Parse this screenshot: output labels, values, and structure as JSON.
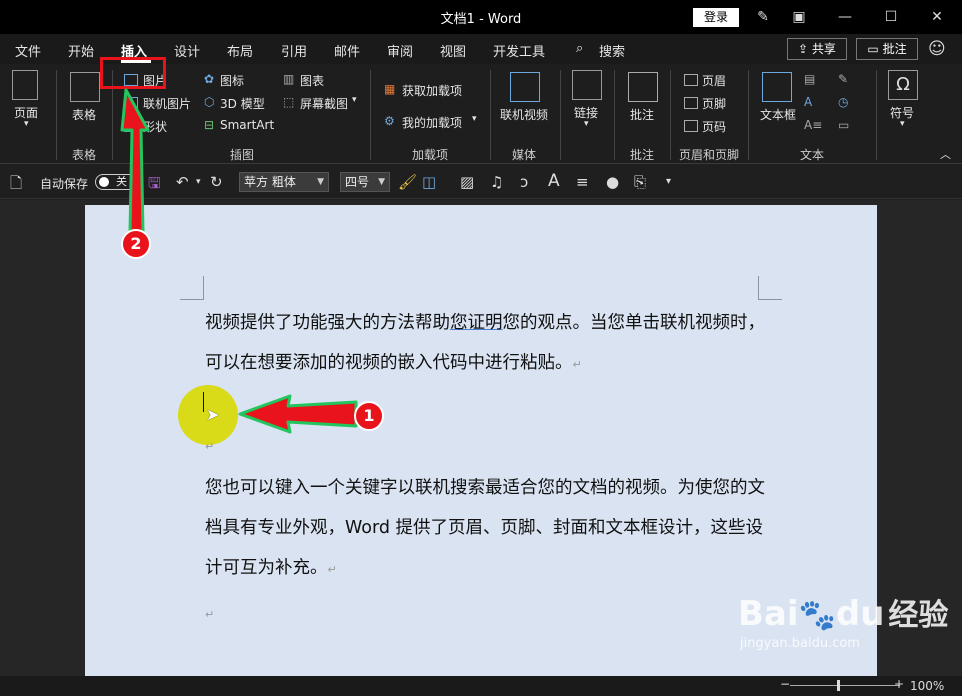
{
  "window": {
    "title": "文档1  -  Word",
    "login_label": "登录"
  },
  "tabs": [
    "文件",
    "开始",
    "插入",
    "设计",
    "布局",
    "引用",
    "邮件",
    "审阅",
    "视图",
    "开发工具",
    "搜索"
  ],
  "header_buttons": {
    "share": "共享",
    "comment": "批注"
  },
  "ribbon": {
    "page": "页面",
    "table": "表格",
    "table_group": "表格",
    "insert_items": [
      "图片",
      "联机图片",
      "形状",
      "图标",
      "3D 模型",
      "SmartArt",
      "图表",
      "屏幕截图"
    ],
    "insert_group": "插图",
    "addin_get": "获取加载项",
    "addin_mine": "我的加载项",
    "addin_group": "加载项",
    "online_video": "联机视频",
    "media_group": "媒体",
    "link": "链接",
    "comment": "批注",
    "comment_group": "批注",
    "header": "页眉",
    "footer": "页脚",
    "page_number": "页码",
    "hf_group": "页眉和页脚",
    "textbox": "文本框",
    "text_group": "文本",
    "symbol": "符号"
  },
  "qat": {
    "autosave": "自动保存",
    "toggle_state": "关",
    "font_name": "苹方 粗体",
    "font_size": "四号"
  },
  "document": {
    "para1_a": "视频提供了功能强大的方法帮助",
    "para1_b": "您证明",
    "para1_c": "您的观点。当您单击联机视频时，可以在想要添加的视频的嵌入代码中进行粘贴。",
    "para2": "您也可以键入一个关键字以联机搜索最适合您的文档的视频。为使您的文档具有专业外观，Word 提供了页眉、页脚、封面和文本框设计，这些设计可互为补充。",
    "para_mark": "↵"
  },
  "status": {
    "zoom": "100%"
  },
  "annotations": {
    "step1": "1",
    "step2": "2"
  },
  "watermark": {
    "brand": "Bai",
    "du": "du",
    "jy": "经验",
    "url": "jingyan.baidu.com"
  },
  "colors": {
    "accent_red": "#e8131b",
    "arrow_green": "#22c55e",
    "page_bg": "#d9e3f1"
  }
}
